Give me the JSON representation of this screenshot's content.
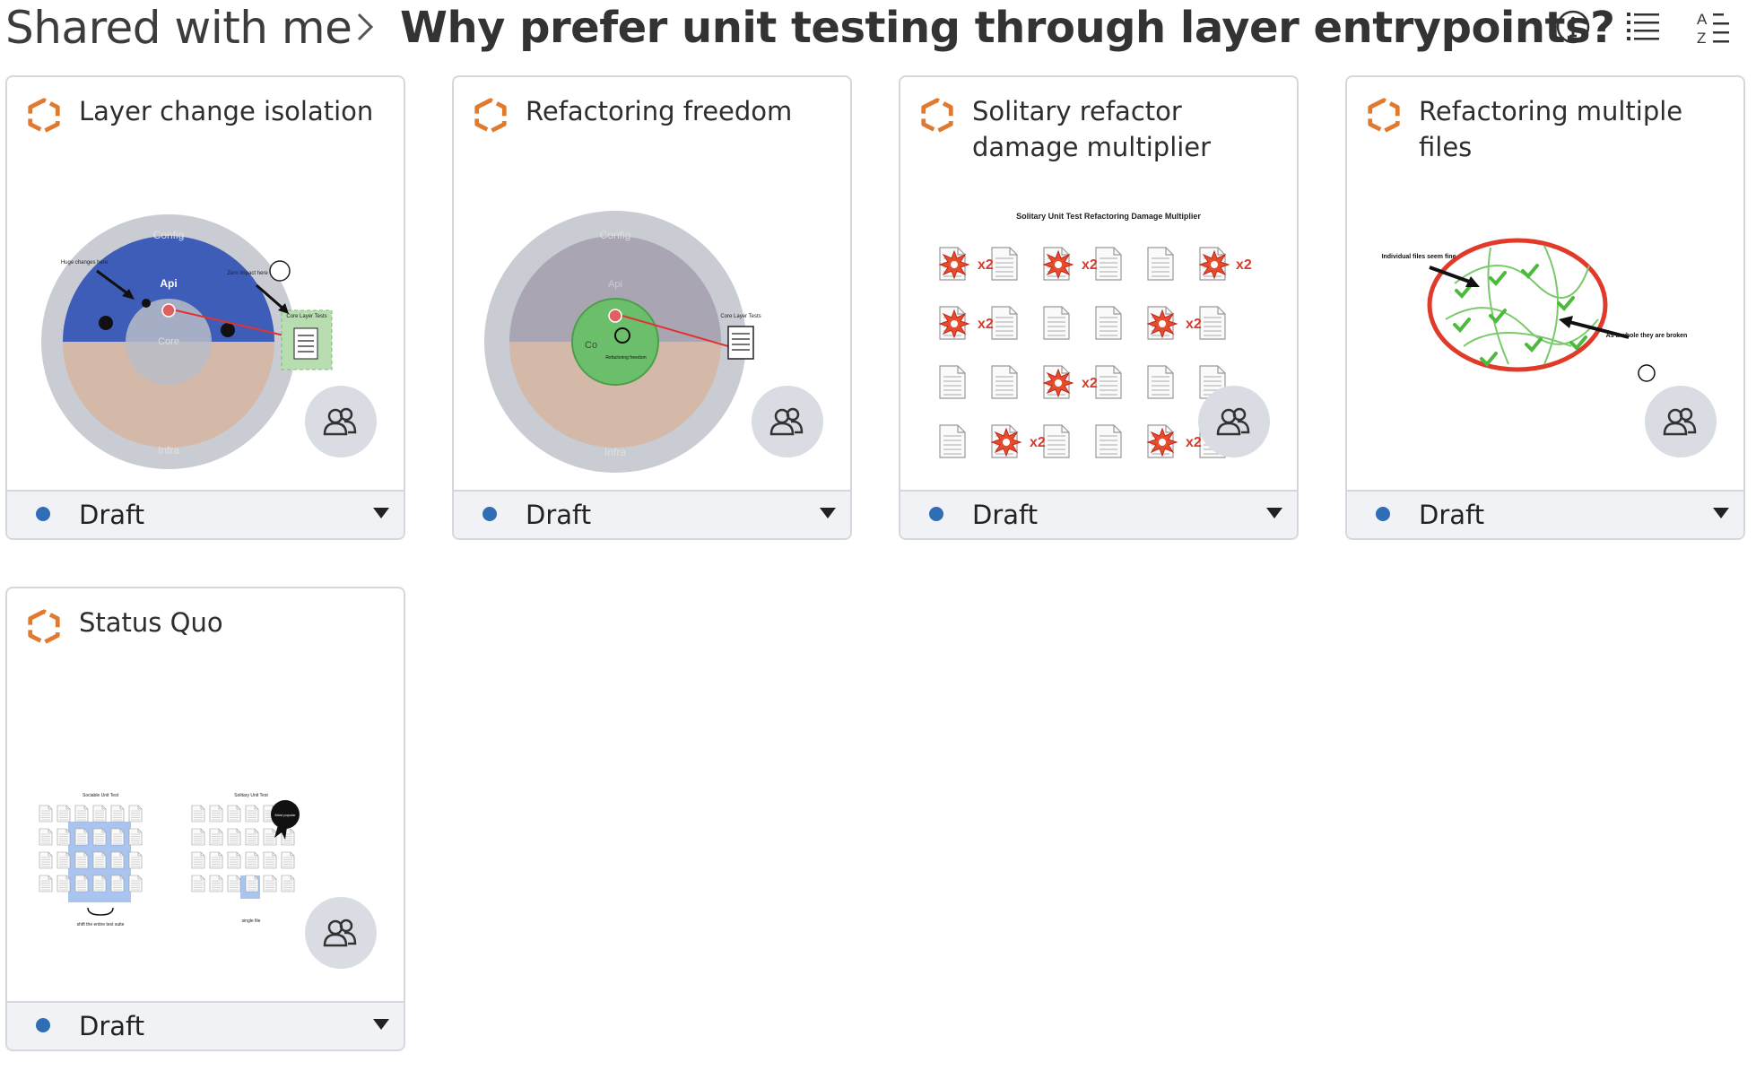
{
  "breadcrumb": {
    "root": "Shared with me",
    "title": "Why prefer unit testing through layer entrypoints?"
  },
  "toolbar": {
    "icons": [
      "info-icon",
      "list-view-icon",
      "sort-az-icon"
    ]
  },
  "colors": {
    "accent_orange": "#e07a2e",
    "status_blue": "#2f6db5",
    "card_border": "#d4d8de",
    "footer_bg": "#f0f2f5"
  },
  "cards": [
    {
      "title": "Layer change isolation",
      "status": "Draft",
      "thumb_text": {
        "config": "Config",
        "api": "Api",
        "core": "Core",
        "infra": "Infra",
        "note1": "Huge changes here",
        "note2": "Zero impact here",
        "tests": "Core Layer Tests"
      }
    },
    {
      "title": "Refactoring freedom",
      "status": "Draft",
      "thumb_text": {
        "config": "Config",
        "api": "Api",
        "core": "Co",
        "infra": "Infra",
        "tests": "Core Layer Tests",
        "zone": "Refactoring freedom"
      }
    },
    {
      "title": "Solitary refactor damage multiplier",
      "status": "Draft",
      "thumb_text": {
        "heading": "Solitary Unit Test Refactoring Damage Multiplier",
        "mult": "x2"
      }
    },
    {
      "title": "Refactoring multiple files",
      "status": "Draft",
      "thumb_text": {
        "note1": "Individual files seem fine",
        "note2": "As a whole they are broken"
      }
    },
    {
      "title": "Status Quo",
      "status": "Draft",
      "thumb_text": {
        "left_title": "Sociable Unit Test",
        "right_title": "Solitary Unit Test",
        "left_note": "shift the entire test suite",
        "right_note": "single file",
        "badge": "Most popular"
      }
    }
  ]
}
